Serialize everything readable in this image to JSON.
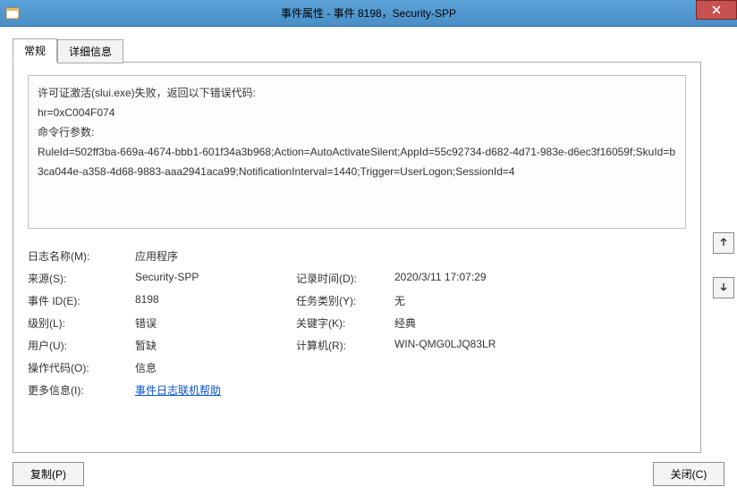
{
  "window": {
    "title": "事件属性 - 事件 8198，Security-SPP"
  },
  "tabs": {
    "general": "常规",
    "details": "详细信息"
  },
  "description": {
    "line1": "许可证激活(slui.exe)失败，返回以下错误代码:",
    "line2": "hr=0xC004F074",
    "line3": "命令行参数:",
    "line4": "RuleId=502ff3ba-669a-4674-bbb1-601f34a3b968;Action=AutoActivateSilent;AppId=55c92734-d682-4d71-983e-d6ec3f16059f;SkuId=b3ca044e-a358-4d68-9883-aaa2941aca99;NotificationInterval=1440;Trigger=UserLogon;SessionId=4"
  },
  "fields": {
    "logNameLabel": "日志名称(M):",
    "logName": "应用程序",
    "sourceLabel": "来源(S):",
    "source": "Security-SPP",
    "loggedLabel": "记录时间(D):",
    "logged": "2020/3/11 17:07:29",
    "eventIdLabel": "事件 ID(E):",
    "eventId": "8198",
    "taskCatLabel": "任务类别(Y):",
    "taskCat": "无",
    "levelLabel": "级别(L):",
    "level": "错误",
    "keywordsLabel": "关键字(K):",
    "keywords": "经典",
    "userLabel": "用户(U):",
    "user": "暂缺",
    "computerLabel": "计算机(R):",
    "computer": "WIN-QMG0LJQ83LR",
    "opcodeLabel": "操作代码(O):",
    "opcode": "信息",
    "moreInfoLabel": "更多信息(I):",
    "moreInfoLink": "事件日志联机帮助"
  },
  "buttons": {
    "copy": "复制(P)",
    "close": "关闭(C)"
  }
}
